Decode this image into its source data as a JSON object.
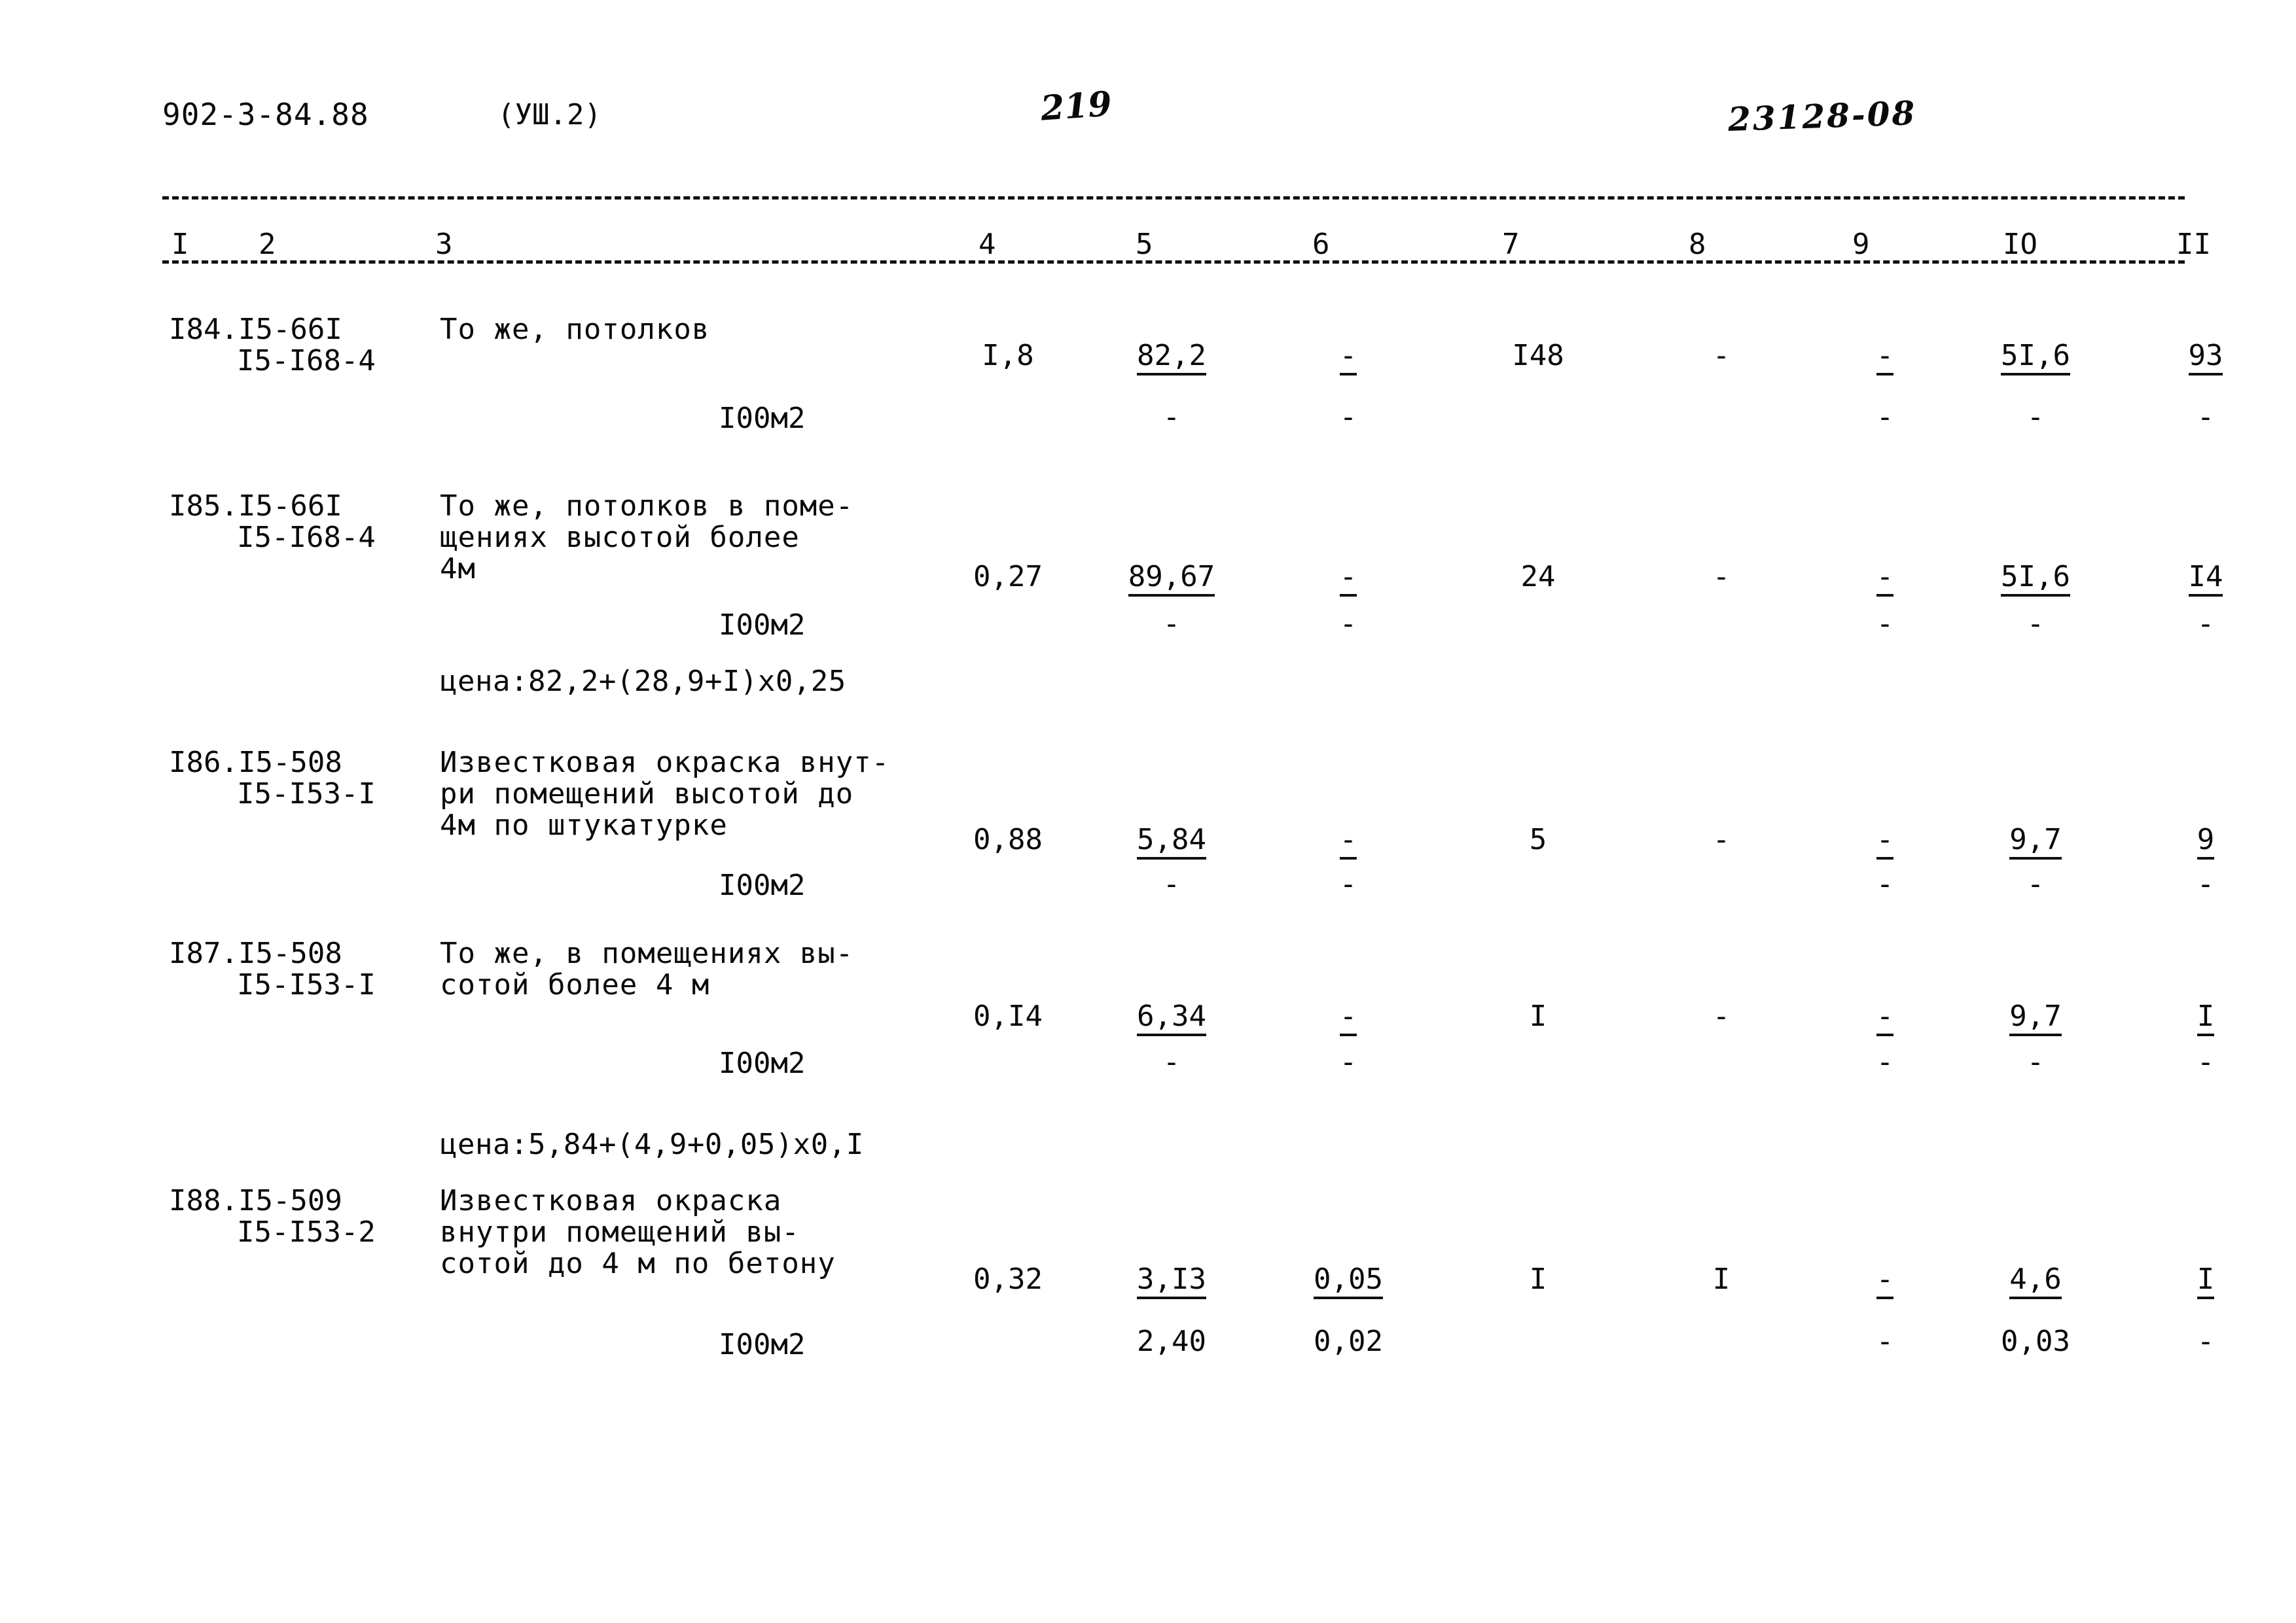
{
  "header": {
    "document_code": "902-3-84.88",
    "volume": "(УШ.2)",
    "page_number": "219",
    "archive_stamp": "23128-08"
  },
  "table": {
    "column_numbers": [
      "I",
      "2",
      "3",
      "4",
      "5",
      "6",
      "7",
      "8",
      "9",
      "IO",
      "II"
    ],
    "unit_label": "I00м2",
    "dash": "-",
    "rows": [
      {
        "id": "row-184",
        "code_line1": "I84.I5-66I",
        "code_line2": "I5-I68-4",
        "desc_lines": [
          "То же, потолков"
        ],
        "unit": "I00м2",
        "c4": "I,8",
        "c5_top": "82,2",
        "c5_bot": "-",
        "c6_top": "-",
        "c6_bot": "-",
        "c7": "I48",
        "c8": "-",
        "c9_top": "-",
        "c9_bot": "-",
        "c10_top": "5I,6",
        "c10_bot": "-",
        "c11_top": "93",
        "c11_bot": "-"
      },
      {
        "id": "row-185",
        "code_line1": "I85.I5-66I",
        "code_line2": "I5-I68-4",
        "desc_lines": [
          "То же, потолков в поме-",
          "щениях высотой более",
          "4м"
        ],
        "unit": "I00м2",
        "c4": "0,27",
        "c5_top": "89,67",
        "c5_bot": "-",
        "c6_top": "-",
        "c6_bot": "-",
        "c7": "24",
        "c8": "-",
        "c9_top": "-",
        "c9_bot": "-",
        "c10_top": "5I,6",
        "c10_bot": "-",
        "c11_top": "I4",
        "c11_bot": "-",
        "price_note": "цена:82,2+(28,9+I)х0,25"
      },
      {
        "id": "row-186",
        "code_line1": "I86.I5-508",
        "code_line2": "I5-I53-I",
        "desc_lines": [
          "Известковая окраска внут-",
          "ри помещений высотой до",
          "4м по штукатурке"
        ],
        "unit": "I00м2",
        "c4": "0,88",
        "c5_top": "5,84",
        "c5_bot": "-",
        "c6_top": "-",
        "c6_bot": "-",
        "c7": "5",
        "c8": "-",
        "c9_top": "-",
        "c9_bot": "-",
        "c10_top": "9,7",
        "c10_bot": "-",
        "c11_top": "9",
        "c11_bot": "-"
      },
      {
        "id": "row-187",
        "code_line1": "I87.I5-508",
        "code_line2": "I5-I53-I",
        "desc_lines": [
          "То же, в помещениях вы-",
          "сотой более 4 м"
        ],
        "unit": "I00м2",
        "c4": "0,I4",
        "c5_top": "6,34",
        "c5_bot": "-",
        "c6_top": "-",
        "c6_bot": "-",
        "c7": "I",
        "c8": "-",
        "c9_top": "-",
        "c9_bot": "-",
        "c10_top": "9,7",
        "c10_bot": "-",
        "c11_top": "I",
        "c11_bot": "-",
        "price_note": "цена:5,84+(4,9+0,05)х0,I"
      },
      {
        "id": "row-188",
        "code_line1": "I88.I5-509",
        "code_line2": "I5-I53-2",
        "desc_lines": [
          "Известковая окраска",
          "внутри помещений вы-",
          "сотой до 4 м по бетону"
        ],
        "unit": "I00м2",
        "c4": "0,32",
        "c5_top": "3,I3",
        "c5_bot": "2,40",
        "c6_top": "0,05",
        "c6_bot": "0,02",
        "c7": "I",
        "c8": "I",
        "c9_top": "-",
        "c9_bot": "-",
        "c10_top": "4,6",
        "c10_bot": "0,03",
        "c11_top": "I",
        "c11_bot": "-"
      }
    ]
  }
}
